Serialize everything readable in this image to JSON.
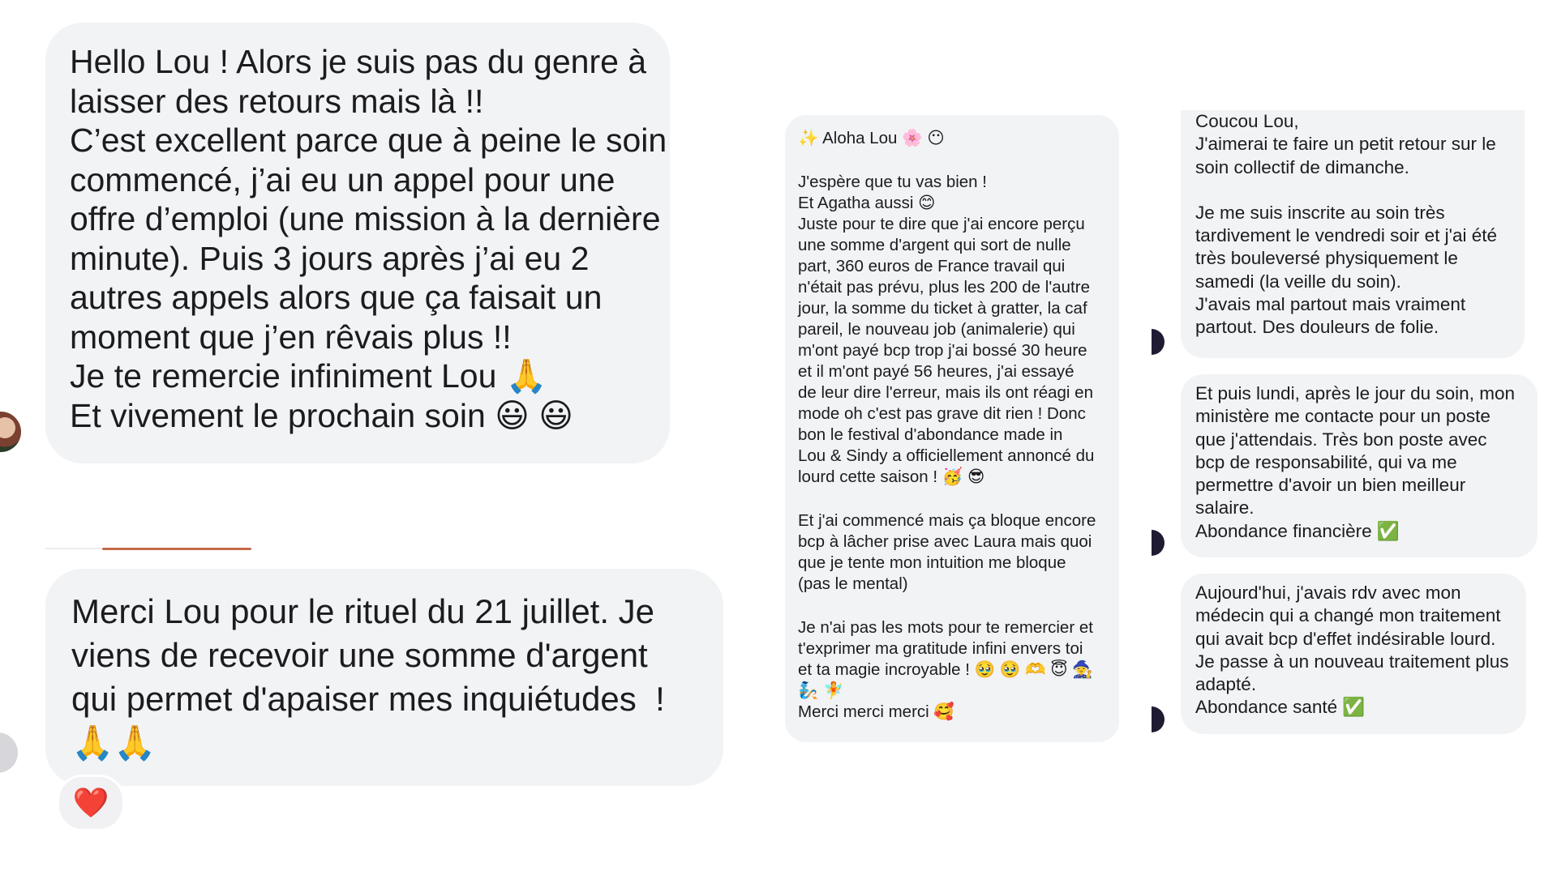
{
  "left_messages": [
    {
      "lines": [
        "Hello Lou ! Alors je suis pas du genre à",
        "laisser des retours mais là !!",
        "C’est excellent parce que à peine le soin",
        "commencé, j’ai eu un appel pour une",
        "offre d’emploi (une mission à la dernière",
        "minute). Puis 3 jours après j’ai eu 2",
        "autres appels alors que ça faisait un",
        "moment que j’en rêvais plus !!",
        "Je te remercie infiniment Lou 🙏",
        "Et vivement le prochain soin 😃 😃"
      ]
    },
    {
      "lines": [
        "Merci Lou pour le rituel du 21 juillet. Je",
        "viens de recevoir une somme d'argent",
        "qui permet d'apaiser mes inquiétudes  !",
        "🙏🙏"
      ],
      "reaction": "❤️"
    }
  ],
  "middle_message": {
    "paragraphs": [
      [
        "✨ Aloha Lou 🌸 😶"
      ],
      [
        "J'espère que tu vas bien !",
        "Et Agatha aussi 😊",
        "Juste pour te dire que j'ai encore perçu",
        "une somme d'argent qui sort de nulle",
        "part, 360 euros de France travail qui",
        "n'était pas prévu, plus les 200 de l'autre",
        "jour, la somme du ticket à gratter, la caf",
        "pareil, le nouveau job (animalerie) qui",
        "m'ont payé bcp trop j'ai bossé 30 heure",
        "et il m'ont payé 56 heures, j'ai essayé",
        "de leur dire l'erreur, mais ils ont réagi en",
        "mode oh c'est pas grave dit rien ! Donc",
        "bon le festival d'abondance made in",
        "Lou & Sindy a officiellement annoncé du",
        "lourd cette saison ! 🥳 😎"
      ],
      [
        "Et j'ai commencé mais ça bloque encore",
        "bcp à lâcher prise avec Laura mais quoi",
        "que je tente mon intuition me bloque",
        "(pas le mental)"
      ],
      [
        "Je n'ai pas les mots pour te remercier et",
        "t'exprimer ma gratitude infini envers toi",
        "et ta magie incroyable ! 🥹 🥹 🫶 😇 🧙",
        "🧞 🧚",
        "Merci merci merci 🥰"
      ]
    ]
  },
  "right_messages": [
    {
      "paragraphs": [
        [
          "Coucou Lou,",
          "J'aimerai te faire un petit retour sur le",
          "soin collectif de dimanche."
        ],
        [
          "Je me suis inscrite au soin très",
          "tardivement le vendredi soir et j'ai été",
          "très bouleversé physiquement le",
          "samedi (la veille du soin).",
          "J'avais mal partout mais vraiment",
          "partout. Des douleurs de folie."
        ]
      ]
    },
    {
      "paragraphs": [
        [
          "Et puis lundi, après le jour du soin, mon",
          "ministère me contacte pour un poste",
          "que j'attendais. Très bon poste avec",
          "bcp de responsabilité, qui va me",
          "permettre d'avoir un bien meilleur",
          "salaire.",
          "Abondance financière ✅"
        ]
      ]
    },
    {
      "paragraphs": [
        [
          "Aujourd'hui, j'avais rdv avec mon",
          "médecin qui a changé mon traitement",
          "qui avait bcp d'effet indésirable lourd.",
          "Je passe à un nouveau traitement plus",
          "adapté.",
          "Abondance santé ✅"
        ]
      ]
    }
  ]
}
